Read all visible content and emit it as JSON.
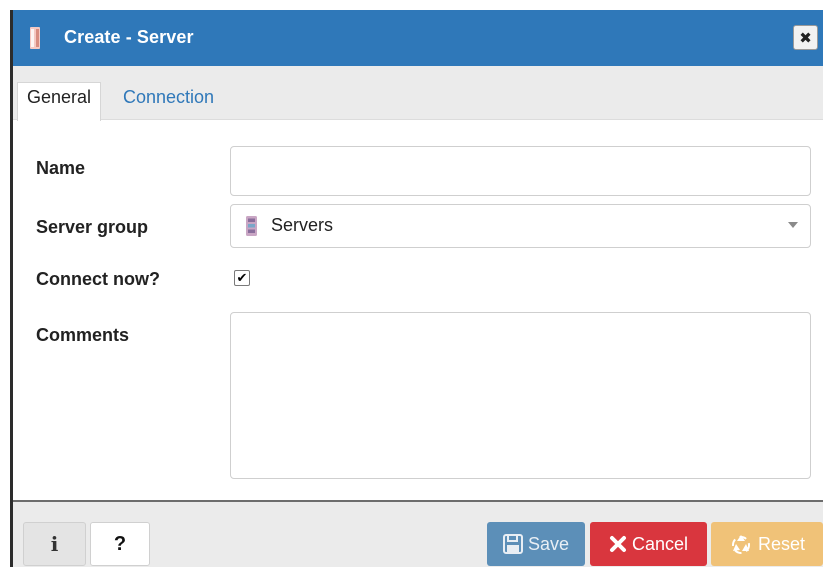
{
  "dialog": {
    "title": "Create - Server",
    "title_icon": "server-icon",
    "close_label": "✖"
  },
  "tabs": [
    {
      "label": "General",
      "active": true
    },
    {
      "label": "Connection",
      "active": false
    }
  ],
  "form": {
    "name": {
      "label": "Name",
      "value": ""
    },
    "server_group": {
      "label": "Server group",
      "selected": "Servers",
      "icon": "server-group-icon"
    },
    "connect_now": {
      "label": "Connect now?",
      "checked": true,
      "mark": "✔"
    },
    "comments": {
      "label": "Comments",
      "value": ""
    }
  },
  "footer": {
    "info_label": "i",
    "help_label": "?",
    "save_label": "Save",
    "cancel_label": "Cancel",
    "reset_label": "Reset"
  },
  "colors": {
    "titlebar": "#2f78b9",
    "save": "#5c8fb8",
    "cancel": "#d9363e",
    "reset": "#f0c278"
  }
}
